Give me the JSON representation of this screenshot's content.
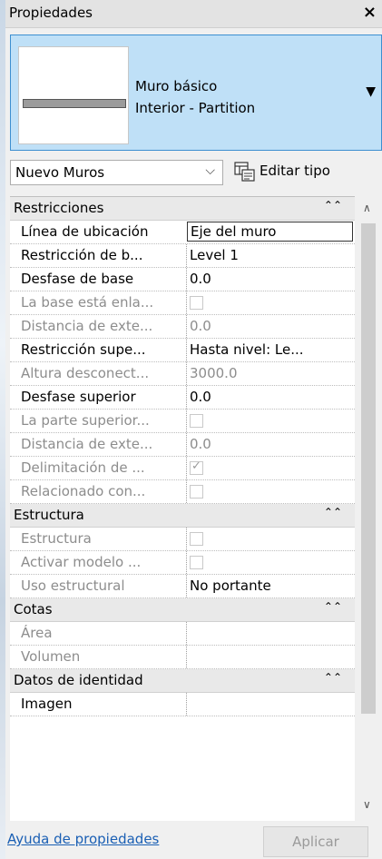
{
  "window": {
    "title": "Propiedades",
    "close_icon": "×"
  },
  "type_selector": {
    "family": "Muro básico",
    "type": "Interior - Partition",
    "dropdown_icon": "▼"
  },
  "filter": {
    "selected": "Nuevo Muros",
    "chevron": "⌵",
    "edit_type_label": "Editar tipo"
  },
  "grid": {
    "collapse_glyph": "⌃⌃",
    "categories": [
      {
        "title": "Restricciones",
        "rows": [
          {
            "name": "Línea de ubicación",
            "value": "Eje del muro"
          },
          {
            "name": "Restricción de b...",
            "value": "Level 1"
          },
          {
            "name": "Desfase de base",
            "value": "0.0"
          },
          {
            "name": "La base está enla...",
            "value": ""
          },
          {
            "name": "Distancia de exte...",
            "value": "0.0"
          },
          {
            "name": "Restricción supe...",
            "value": "Hasta nivel: Le..."
          },
          {
            "name": "Altura desconect...",
            "value": "3000.0"
          },
          {
            "name": "Desfase superior",
            "value": "0.0"
          },
          {
            "name": "La parte superior...",
            "value": ""
          },
          {
            "name": "Distancia de exte...",
            "value": "0.0"
          },
          {
            "name": "Delimitación de ...",
            "value": ""
          },
          {
            "name": "Relacionado con...",
            "value": ""
          }
        ]
      },
      {
        "title": "Estructura",
        "rows": [
          {
            "name": "Estructura",
            "value": ""
          },
          {
            "name": "Activar modelo ...",
            "value": ""
          },
          {
            "name": "Uso estructural",
            "value": "No portante"
          }
        ]
      },
      {
        "title": "Cotas",
        "rows": [
          {
            "name": "Área",
            "value": ""
          },
          {
            "name": "Volumen",
            "value": ""
          }
        ]
      },
      {
        "title": "Datos de identidad",
        "rows": [
          {
            "name": "Imagen",
            "value": ""
          }
        ]
      }
    ]
  },
  "scroll": {
    "up_icon": "∧",
    "down_icon": "∨"
  },
  "footer": {
    "help_link": "Ayuda de propiedades",
    "apply_button": "Aplicar"
  },
  "colors": {
    "selector_bg": "#bfe0f7",
    "selector_border": "#3d8fd0",
    "link": "#1a5fb4",
    "disabled_text": "#8d8d8d"
  }
}
